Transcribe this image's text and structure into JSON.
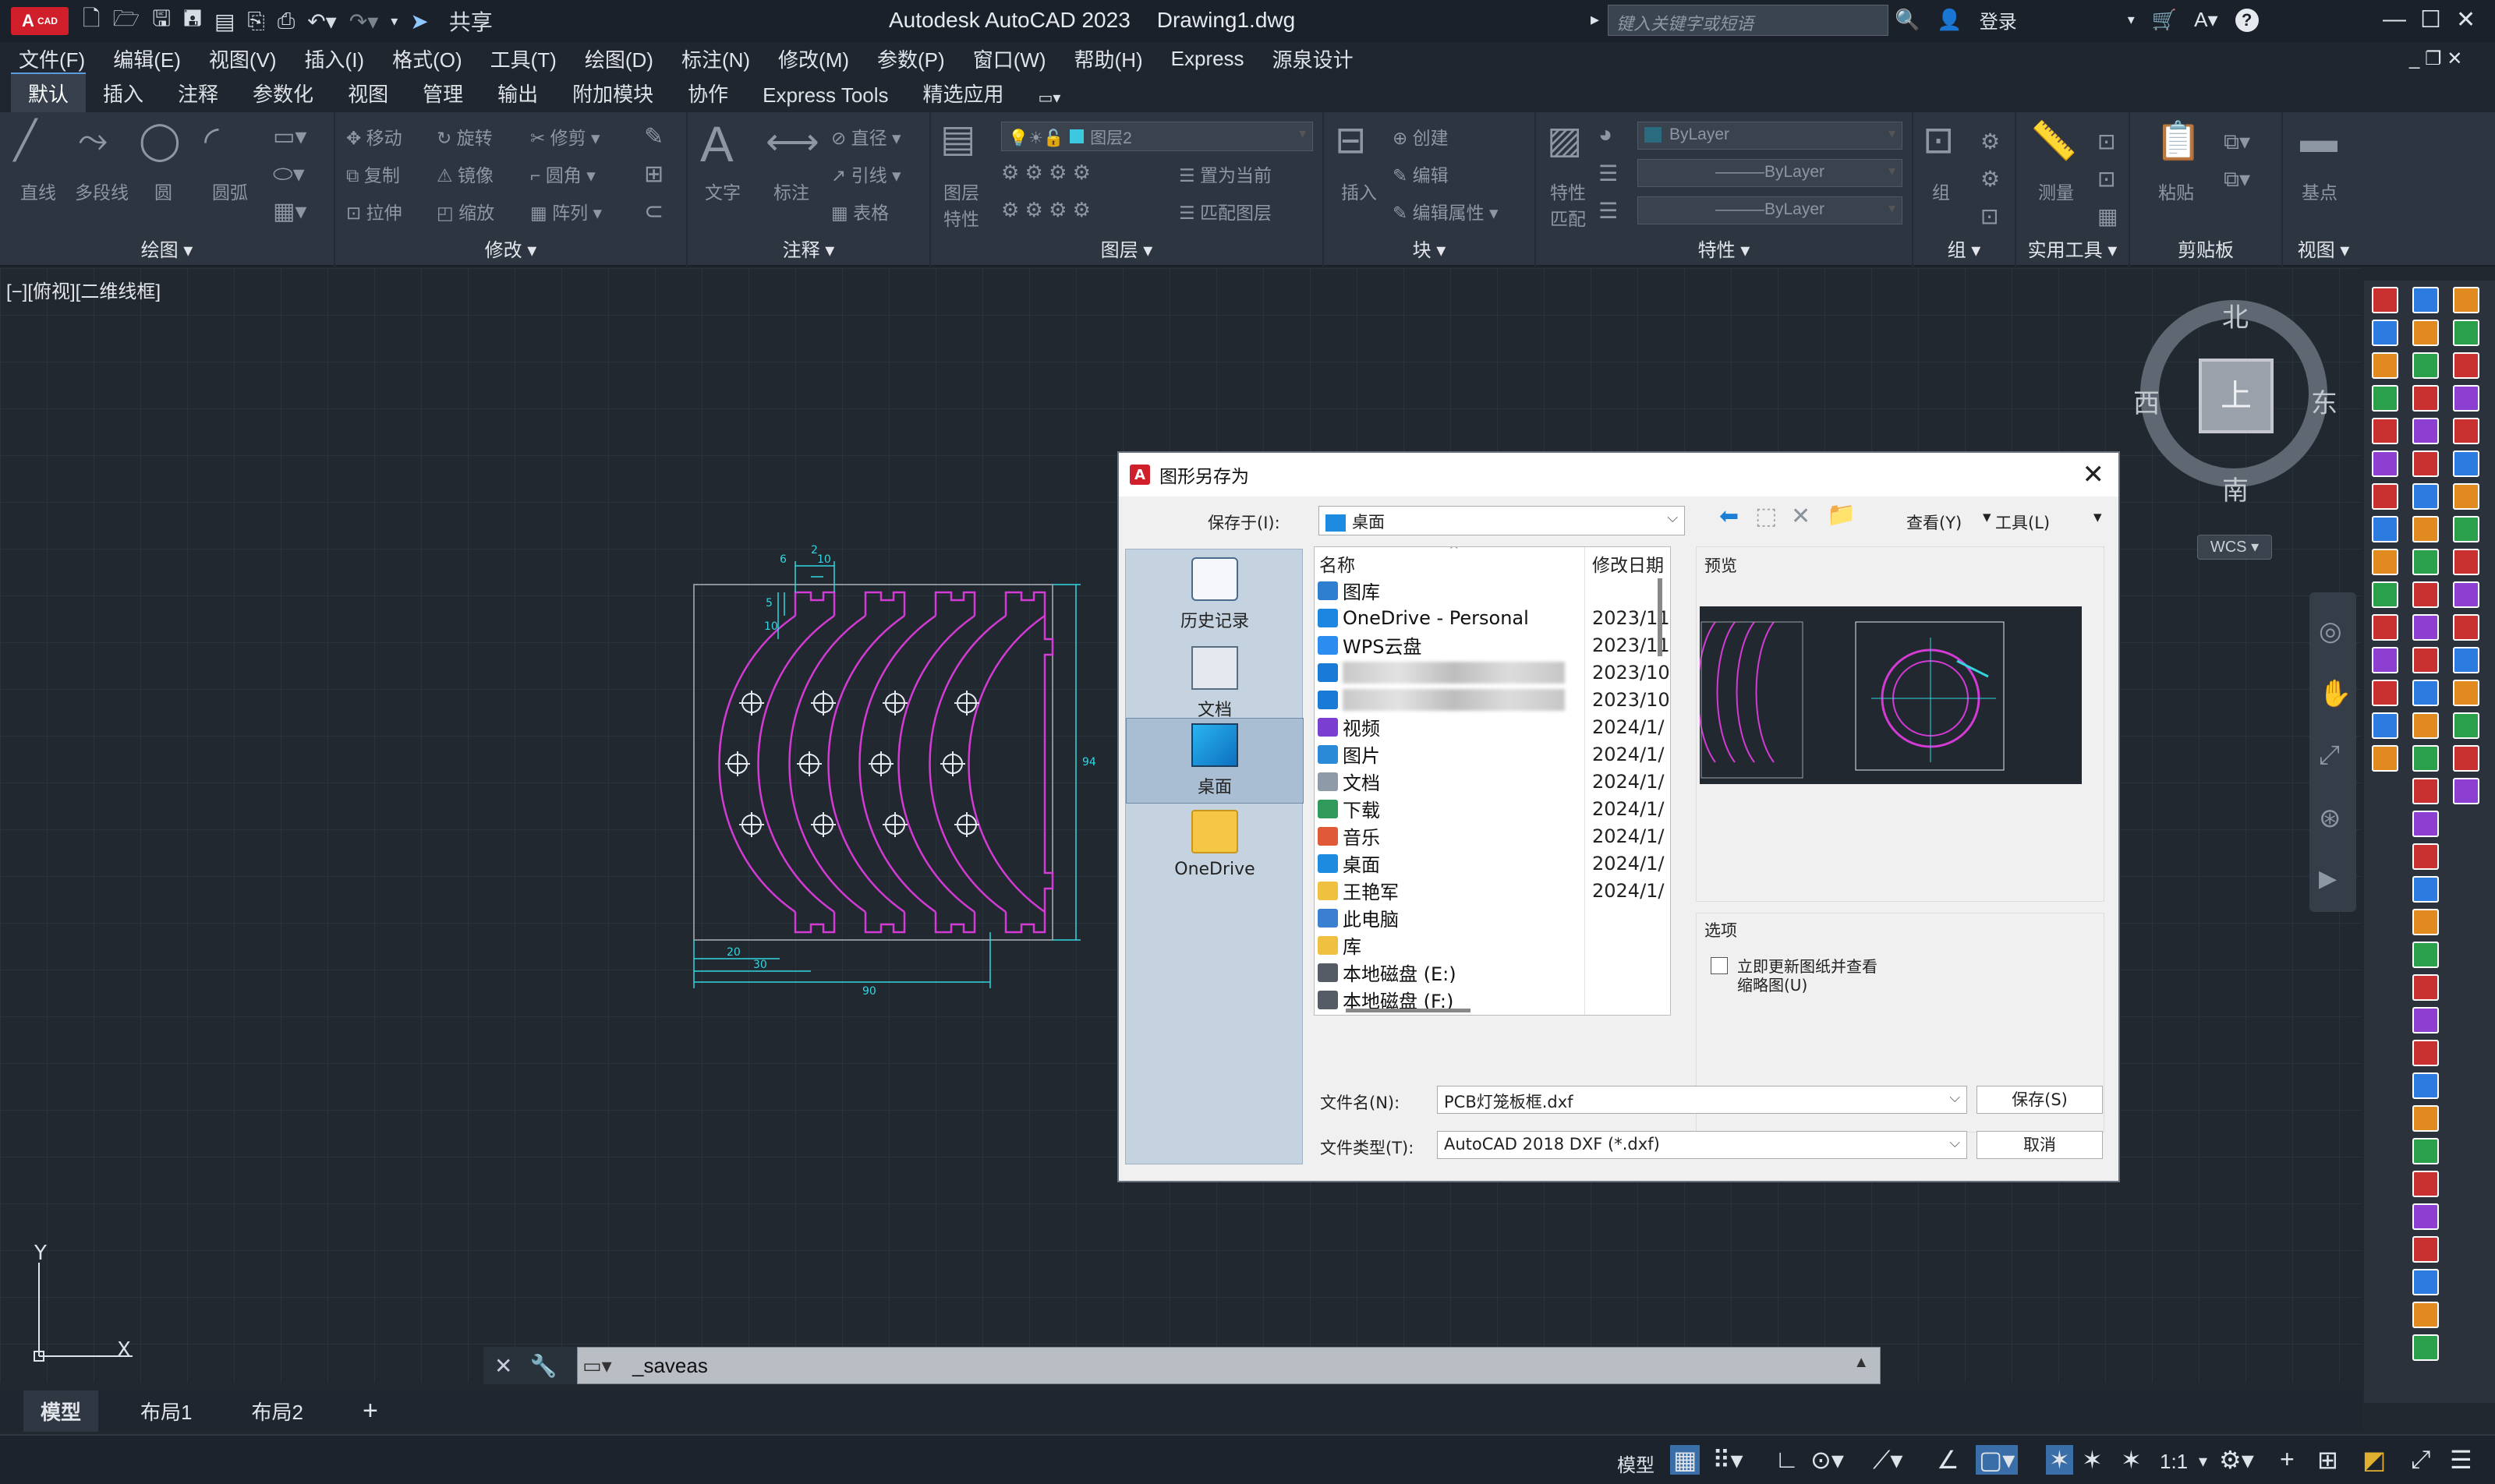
{
  "app": {
    "logo_text": "A",
    "logo_sub": "CAD",
    "title": "Autodesk AutoCAD 2023",
    "filename": "Drawing1.dwg",
    "share": "共享",
    "search_placeholder": "键入关键字或短语",
    "login": "登录"
  },
  "menu": [
    "文件(F)",
    "编辑(E)",
    "视图(V)",
    "插入(I)",
    "格式(O)",
    "工具(T)",
    "绘图(D)",
    "标注(N)",
    "修改(M)",
    "参数(P)",
    "窗口(W)",
    "帮助(H)",
    "Express",
    "源泉设计"
  ],
  "tabs": [
    "默认",
    "插入",
    "注释",
    "参数化",
    "视图",
    "管理",
    "输出",
    "附加模块",
    "协作",
    "Express Tools",
    "精选应用"
  ],
  "panels": {
    "draw": {
      "label": "绘图",
      "tools": [
        "直线",
        "多段线",
        "圆",
        "圆弧"
      ]
    },
    "modify": {
      "label": "修改",
      "tools": [
        "移动",
        "旋转",
        "修剪",
        "复制",
        "镜像",
        "圆角",
        "拉伸",
        "缩放",
        "阵列"
      ]
    },
    "annotation": {
      "label": "注释",
      "tools": [
        "文字",
        "标注",
        "直径",
        "引线",
        "表格"
      ]
    },
    "layers": {
      "label": "图层",
      "tools": [
        "图层特性",
        "置为当前",
        "匹配图层"
      ],
      "current_layer": "图层2"
    },
    "block": {
      "label": "块",
      "tools": [
        "插入",
        "创建",
        "编辑",
        "编辑属性"
      ]
    },
    "properties": {
      "label": "特性",
      "tools": [
        "特性匹配"
      ],
      "color": "ByLayer",
      "linetype": "ByLayer",
      "lineweight": "ByLayer"
    },
    "groups": {
      "label": "组",
      "tools": [
        "组"
      ]
    },
    "utilities": {
      "label": "实用工具",
      "tools": [
        "测量"
      ]
    },
    "clipboard": {
      "label": "剪贴板",
      "tools": [
        "粘贴"
      ]
    },
    "view": {
      "label": "视图",
      "tools": [
        "基点"
      ]
    }
  },
  "viewport": {
    "label": "[−][俯视][二维线框]",
    "ucs_x": "X",
    "ucs_y": "Y"
  },
  "navcube": {
    "north": "北",
    "south": "南",
    "east": "东",
    "west": "西",
    "top": "上",
    "wcs": "WCS"
  },
  "drawing_dims": {
    "d2": "2",
    "d6": "6",
    "d10top": "10",
    "d5": "5",
    "d10side": "10",
    "d94": "94",
    "d20": "20",
    "d30": "30",
    "d90": "90"
  },
  "dialog": {
    "title": "图形另存为",
    "save_in_label": "保存于(I):",
    "save_in_value": "桌面",
    "view_menu": "查看(Y)",
    "tools_menu": "工具(L)",
    "places": [
      "历史记录",
      "文档",
      "桌面",
      "OneDrive"
    ],
    "col_name": "名称",
    "col_date": "修改日期",
    "files": [
      {
        "name": "图库",
        "date": "",
        "icon": "#2f7fd1"
      },
      {
        "name": "OneDrive - Personal",
        "date": "2023/11",
        "icon": "#1d86e0"
      },
      {
        "name": "WPS云盘",
        "date": "2023/11",
        "icon": "#2d8cf0"
      },
      {
        "name": "",
        "date": "2023/10",
        "icon": "#1a7bd6"
      },
      {
        "name": "",
        "date": "2023/10",
        "icon": "#1a7bd6"
      },
      {
        "name": "视频",
        "date": "2024/1/",
        "icon": "#7a3fd0"
      },
      {
        "name": "图片",
        "date": "2024/1/",
        "icon": "#2a8ad8"
      },
      {
        "name": "文档",
        "date": "2024/1/",
        "icon": "#8f9aa8"
      },
      {
        "name": "下载",
        "date": "2024/1/",
        "icon": "#2f9a5a"
      },
      {
        "name": "音乐",
        "date": "2024/1/",
        "icon": "#e05a3a"
      },
      {
        "name": "桌面",
        "date": "2024/1/",
        "icon": "#1c8be0"
      },
      {
        "name": "王艳军",
        "date": "2024/1/",
        "icon": "#f0c040"
      },
      {
        "name": "此电脑",
        "date": "",
        "icon": "#3a7fd0"
      },
      {
        "name": "库",
        "date": "",
        "icon": "#f0c040"
      },
      {
        "name": "本地磁盘 (E:)",
        "date": "",
        "icon": "#555c66"
      },
      {
        "name": "本地磁盘 (F:)",
        "date": "",
        "icon": "#555c66"
      }
    ],
    "preview_label": "预览",
    "options_label": "选项",
    "option_checkbox": "立即更新图纸并查看",
    "option_checkbox2": "缩略图(U)",
    "filename_label": "文件名(N):",
    "filename_value": "PCB灯笼板框.dxf",
    "filetype_label": "文件类型(T):",
    "filetype_value": "AutoCAD 2018 DXF (*.dxf)",
    "save_button": "保存(S)",
    "cancel_button": "取消"
  },
  "command": {
    "text": "_saveas"
  },
  "layouts": [
    "模型",
    "布局1",
    "布局2"
  ],
  "status": {
    "model": "模型",
    "scale": "1:1"
  }
}
